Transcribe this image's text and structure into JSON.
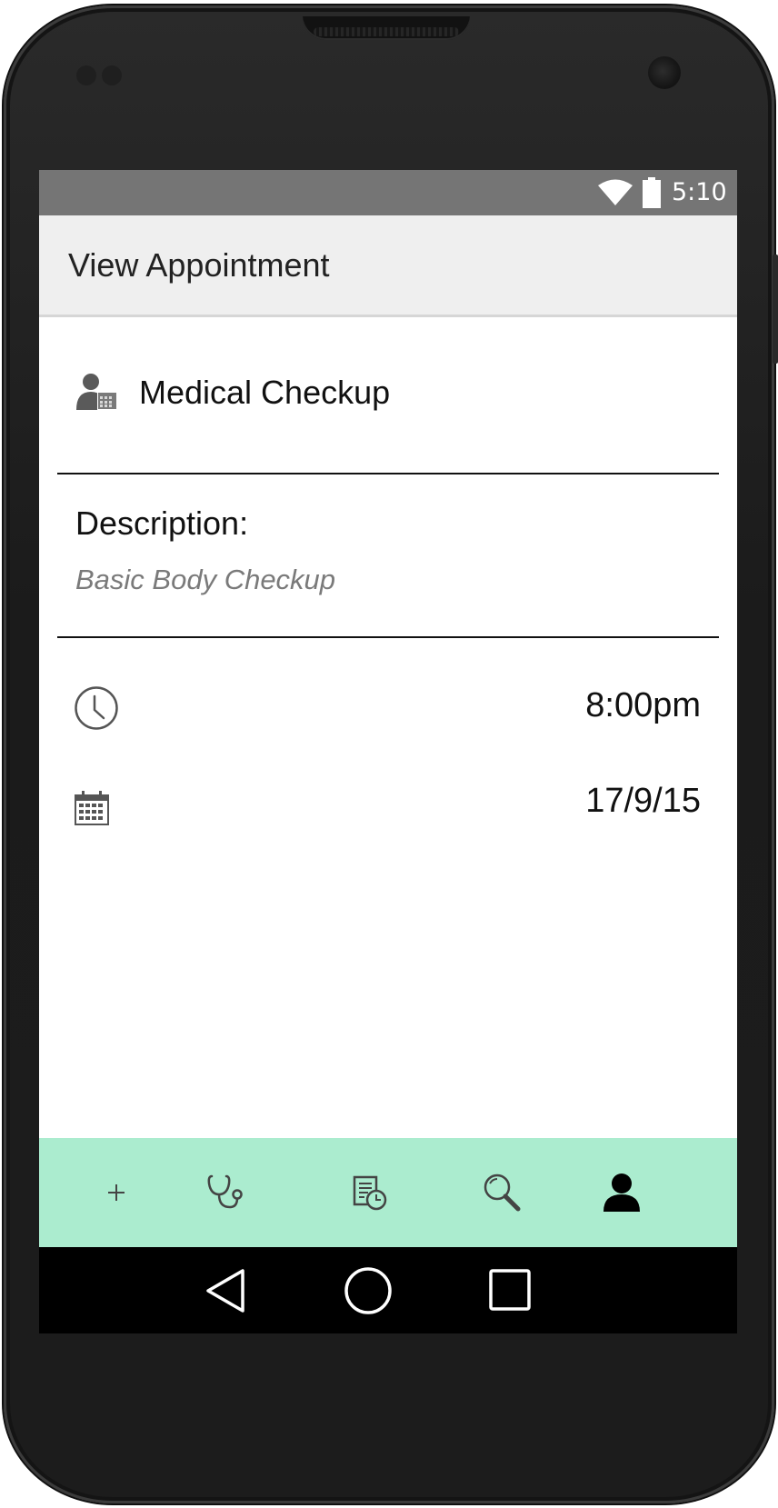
{
  "status_bar": {
    "time": "5:10",
    "icons": [
      "wifi-icon",
      "battery-icon"
    ]
  },
  "app_bar": {
    "title": "View Appointment"
  },
  "appointment": {
    "title": "Medical Checkup",
    "title_icon": "doctor-calendar-icon",
    "description_label": "Description:",
    "description_text": "Basic Body Checkup",
    "time_icon": "clock-icon",
    "time": "8:00pm",
    "date_icon": "calendar-icon",
    "date": "17/9/15"
  },
  "bottom_nav": {
    "items": [
      "plus-icon",
      "stethoscope-icon",
      "schedule-icon",
      "search-icon",
      "person-icon"
    ],
    "background": "#abeccf"
  },
  "system_nav": {
    "items": [
      "back-icon",
      "home-icon",
      "recents-icon"
    ]
  },
  "colors": {
    "status_bar": "#757575",
    "app_bar": "#efefef",
    "description_text": "#7a7a7a"
  }
}
